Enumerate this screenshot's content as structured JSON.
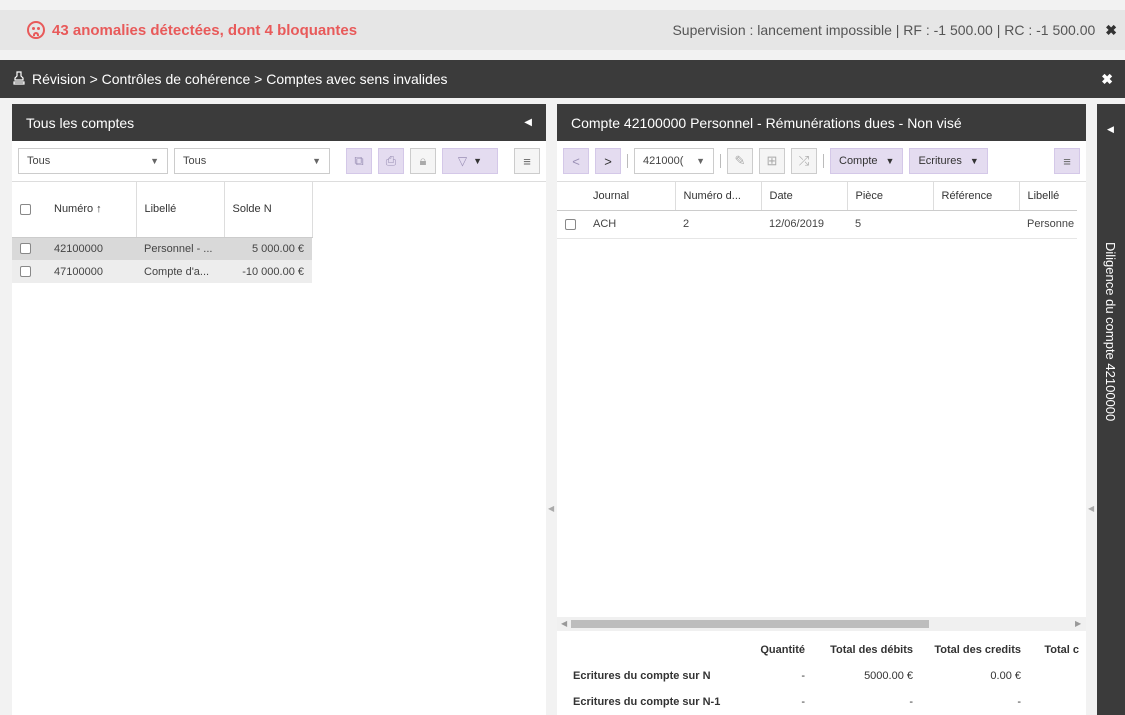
{
  "topbar": {
    "alert": "43 anomalies détectées, dont 4 bloquantes",
    "supervision": "Supervision : lancement impossible | RF : -1 500.00 | RC : -1 500.00",
    "close": "✖"
  },
  "breadcrumb": "Révision > Contrôles de cohérence > Comptes avec sens invalides",
  "left": {
    "title": "Tous les comptes",
    "filter1": "Tous",
    "filter2": "Tous",
    "columns": [
      "Numéro ↑",
      "Libellé",
      "Solde N"
    ],
    "rows": [
      {
        "numero": "42100000",
        "libelle": "Personnel - ...",
        "solde": "5 000.00 €"
      },
      {
        "numero": "47100000",
        "libelle": "Compte d'a...",
        "solde": "-10 000.00 €"
      }
    ]
  },
  "right": {
    "title": "Compte 42100000 Personnel - Rémunérations dues - Non visé",
    "account_select": "421000(",
    "compte_btn": "Compte",
    "ecritures_btn": "Ecritures",
    "columns": [
      "Journal",
      "Numéro d...",
      "Date",
      "Pièce",
      "Référence",
      "Libellé"
    ],
    "rows": [
      {
        "journal": "ACH",
        "numero": "2",
        "date": "12/06/2019",
        "piece": "5",
        "reference": "",
        "libelle": "Personne"
      }
    ],
    "totals": {
      "headers": [
        "Quantité",
        "Total des débits",
        "Total des credits",
        "Total c"
      ],
      "rows": [
        {
          "label": "Ecritures du compte sur N",
          "quantite": "-",
          "debits": "5000.00 €",
          "credits": "0.00 €",
          "total": ""
        },
        {
          "label": "Ecritures du compte sur N-1",
          "quantite": "-",
          "debits": "-",
          "credits": "-",
          "total": ""
        }
      ]
    }
  },
  "sidebar": {
    "label": "Diligence du compte 42100000"
  }
}
